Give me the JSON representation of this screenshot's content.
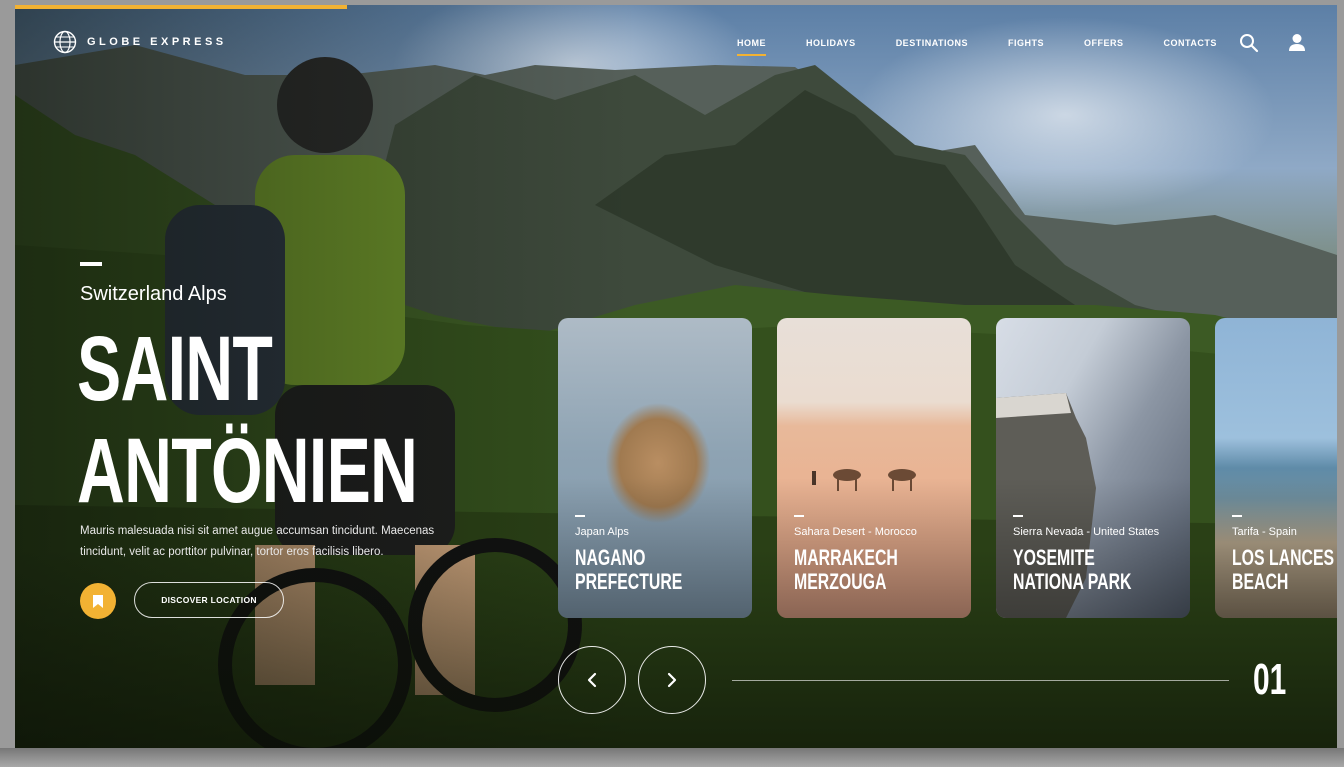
{
  "brand": {
    "name": "GLOBE EXPRESS",
    "icon": "globe-icon"
  },
  "nav": {
    "items": [
      {
        "label": "HOME",
        "active": true
      },
      {
        "label": "HOLIDAYS",
        "active": false
      },
      {
        "label": "DESTINATIONS",
        "active": false
      },
      {
        "label": "FIGHTS",
        "active": false
      },
      {
        "label": "OFFERS",
        "active": false
      },
      {
        "label": "CONTACTS",
        "active": false
      }
    ],
    "icons": [
      "search-icon",
      "user-icon"
    ]
  },
  "hero": {
    "subtitle": "Switzerland Alps",
    "title_line1": "SAINT",
    "title_line2": "ANTÖNIEN",
    "description": "Mauris malesuada nisi sit amet augue accumsan tincidunt. Maecenas tincidunt, velit ac porttitor pulvinar, tortor eros facilisis libero.",
    "discover_label": "DISCOVER LOCATION"
  },
  "cards": [
    {
      "subtitle": "Japan Alps",
      "title_line1": "NAGANO",
      "title_line2": "PREFECTURE"
    },
    {
      "subtitle": "Sahara Desert - Morocco",
      "title_line1": "MARRAKECH",
      "title_line2": "MERZOUGA"
    },
    {
      "subtitle": "Sierra Nevada - United States",
      "title_line1": "YOSEMITE",
      "title_line2": "NATIONA PARK"
    },
    {
      "subtitle": "Tarifa - Spain",
      "title_line1": "LOS LANCES",
      "title_line2": "BEACH"
    }
  ],
  "slider": {
    "current": "01"
  },
  "colors": {
    "accent": "#f2b233",
    "text": "#ffffff"
  }
}
